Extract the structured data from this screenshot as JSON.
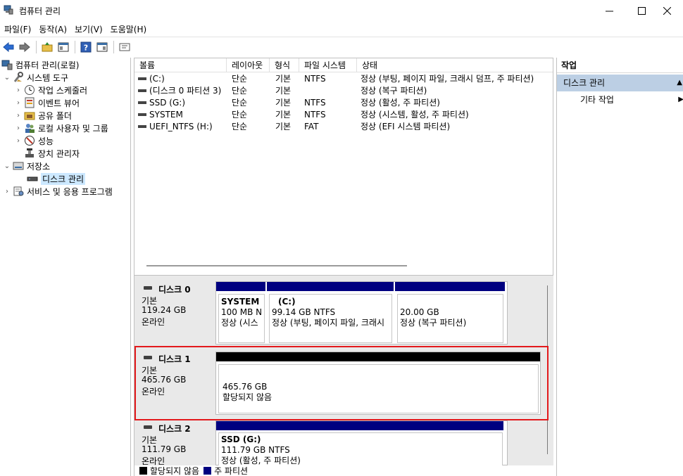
{
  "window": {
    "title": "컴퓨터 관리",
    "minimize_glyph": "—",
    "maximize_glyph": "☐",
    "close_glyph": "✕"
  },
  "menu": [
    "파일(F)",
    "동작(A)",
    "보기(V)",
    "도움말(H)"
  ],
  "tree": {
    "root": "컴퓨터 관리(로컬)",
    "system_tools": "시스템 도구",
    "task_scheduler": "작업 스케줄러",
    "event_viewer": "이벤트 뷰어",
    "shared_folders": "공유 폴더",
    "local_users": "로컬 사용자 및 그룹",
    "performance": "성능",
    "device_manager": "장치 관리자",
    "storage": "저장소",
    "disk_management": "디스크 관리",
    "services": "서비스 및 응용 프로그램"
  },
  "volume_list": {
    "headers": [
      "볼륨",
      "레이아웃",
      "형식",
      "파일 시스템",
      "상태"
    ],
    "rows": [
      {
        "name": "(C:)",
        "layout": "단순",
        "type": "기본",
        "fs": "NTFS",
        "status": "정상 (부팅, 페이지 파일, 크래시 덤프, 주 파티션)"
      },
      {
        "name": "(디스크 0 파티션 3)",
        "layout": "단순",
        "type": "기본",
        "fs": "",
        "status": "정상 (복구 파티션)"
      },
      {
        "name": "SSD (G:)",
        "layout": "단순",
        "type": "기본",
        "fs": "NTFS",
        "status": "정상 (활성, 주 파티션)"
      },
      {
        "name": "SYSTEM",
        "layout": "단순",
        "type": "기본",
        "fs": "NTFS",
        "status": "정상 (시스템, 활성, 주 파티션)"
      },
      {
        "name": "UEFI_NTFS (H:)",
        "layout": "단순",
        "type": "기본",
        "fs": "FAT",
        "status": "정상 (EFI 시스템 파티션)"
      }
    ]
  },
  "disks": {
    "disk0": {
      "name": "디스크 0",
      "kind": "기본",
      "size": "119.24 GB",
      "state": "온라인",
      "p1": {
        "title": "SYSTEM",
        "size": "100 MB N",
        "status": "정상 (시스"
      },
      "p2": {
        "title": "(C:)",
        "size": "99.14 GB NTFS",
        "status": "정상 (부팅, 페이지 파일, 크래시"
      },
      "p3": {
        "size": "20.00 GB",
        "status": "정상 (복구 파티션)"
      }
    },
    "disk1": {
      "name": "디스크 1",
      "kind": "기본",
      "size": "465.76 GB",
      "state": "온라인",
      "p1": {
        "size": "465.76 GB",
        "status": "할당되지 않음"
      }
    },
    "disk2": {
      "name": "디스크 2",
      "kind": "기본",
      "size": "111.79 GB",
      "state": "온라인",
      "p1": {
        "title": "SSD  (G:)",
        "size": "111.79 GB NTFS",
        "status": "정상 (활성, 주 파티션)"
      }
    }
  },
  "legend": {
    "unallocated": "할당되지 않음",
    "primary": "주 파티션"
  },
  "actions": {
    "header": "작업",
    "section": "디스크 관리",
    "more": "기타 작업"
  },
  "colors": {
    "primary_partition": "#000080",
    "unallocated": "#000000",
    "highlight": "#e3191c",
    "section_bg": "#bccfe4",
    "selected_bg": "#cce8ff"
  }
}
